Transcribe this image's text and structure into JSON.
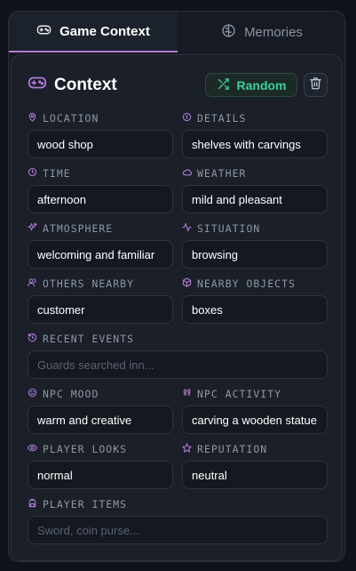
{
  "tabs": [
    {
      "label": "Game Context",
      "icon": "gamepad-icon",
      "active": true
    },
    {
      "label": "Memories",
      "icon": "brain-icon",
      "active": false
    }
  ],
  "header": {
    "title": "Context",
    "random_label": "Random"
  },
  "colors": {
    "accent": "#b07bd6",
    "random_green": "#3fd19a",
    "background": "#161b23"
  },
  "fields": {
    "location": {
      "label": "LOCATION",
      "value": "wood shop",
      "icon": "map-pin-icon"
    },
    "details": {
      "label": "DETAILS",
      "value": "shelves with carvings",
      "icon": "info-icon"
    },
    "time": {
      "label": "TIME",
      "value": "afternoon",
      "icon": "clock-icon"
    },
    "weather": {
      "label": "WEATHER",
      "value": "mild and pleasant",
      "icon": "cloud-icon"
    },
    "atmosphere": {
      "label": "ATMOSPHERE",
      "value": "welcoming and familiar",
      "icon": "sparkles-icon"
    },
    "situation": {
      "label": "SITUATION",
      "value": "browsing",
      "icon": "activity-icon"
    },
    "others_nearby": {
      "label": "OTHERS NEARBY",
      "value": "customer",
      "icon": "users-icon"
    },
    "nearby_objects": {
      "label": "NEARBY OBJECTS",
      "value": "boxes",
      "icon": "box-icon"
    },
    "recent_events": {
      "label": "RECENT EVENTS",
      "placeholder": "Guards searched inn...",
      "icon": "history-icon"
    },
    "npc_mood": {
      "label": "NPC MOOD",
      "value": "warm and creative",
      "icon": "smile-icon"
    },
    "npc_activity": {
      "label": "NPC ACTIVITY",
      "value": "carving a wooden statue",
      "icon": "footprints-icon"
    },
    "player_looks": {
      "label": "PLAYER LOOKS",
      "value": "normal",
      "icon": "eye-icon"
    },
    "reputation": {
      "label": "REPUTATION",
      "value": "neutral",
      "icon": "star-icon"
    },
    "player_items": {
      "label": "PLAYER ITEMS",
      "placeholder": "Sword, coin purse...",
      "icon": "backpack-icon"
    }
  }
}
